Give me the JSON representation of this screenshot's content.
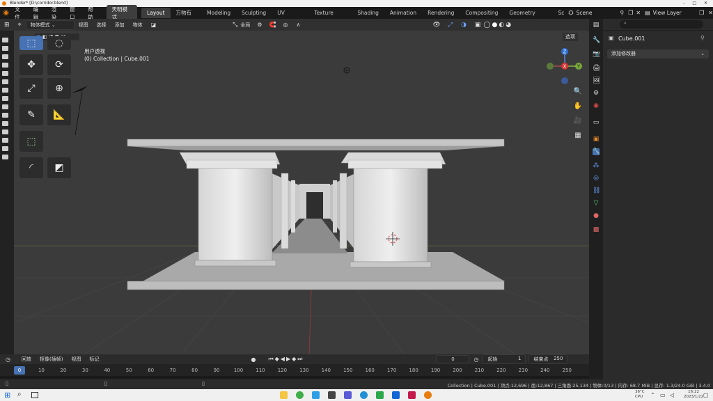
{
  "window": {
    "title": "Blender* [D:\\corridor.blend]"
  },
  "menu": {
    "items": [
      "文件",
      "编辑",
      "渲染",
      "窗口",
      "帮助"
    ],
    "mode_pill": "天明模式",
    "workspaces": [
      "Layout",
      "万物有灵",
      "Modeling",
      "Sculpting",
      "UV Editing",
      "Texture Paint",
      "Shading",
      "Animation",
      "Rendering",
      "Compositing",
      "Geometry Nodes",
      "Sc"
    ],
    "scene": "Scene",
    "view_layer": "View Layer"
  },
  "viewport_header": {
    "mode": "物体模式",
    "menus": [
      "视图",
      "选择",
      "添加",
      "物体"
    ],
    "transform": "全局",
    "options": "选项"
  },
  "viewport": {
    "view_name": "用户透视",
    "collection_info": "(0) Collection | Cube.001"
  },
  "gizmo": {
    "z": "Z",
    "x": "X",
    "y": "Y"
  },
  "properties": {
    "object_name": "Cube.001",
    "add_modifier": "添加修改器",
    "search_placeholder": ""
  },
  "timeline": {
    "menus": [
      "回放",
      "抠像(插帧)",
      "视图",
      "标记"
    ],
    "current_frame": "0",
    "start_label": "起始",
    "start_value": "1",
    "end_label": "结束点",
    "end_value": "250",
    "ticks": [
      "0",
      "10",
      "20",
      "30",
      "40",
      "50",
      "60",
      "70",
      "80",
      "90",
      "100",
      "110",
      "120",
      "130",
      "140",
      "150",
      "160",
      "170",
      "180",
      "190",
      "200",
      "210",
      "220",
      "230",
      "240",
      "250"
    ]
  },
  "status": {
    "text": "Collection | Cube.001 | 顶点:12,696 | 面:12,867 | 三角面:25,134 | 物体:0/13 | 内存: 68.7 MiB | 显存: 1.3/24.0 GiB | 3.4.0"
  },
  "taskbar": {
    "temp": "36°C",
    "cpu": "CPU",
    "time": "16:22",
    "date": "2023/1/22"
  },
  "colors": {
    "accent": "#4772b3",
    "orange": "#e87d0d"
  }
}
